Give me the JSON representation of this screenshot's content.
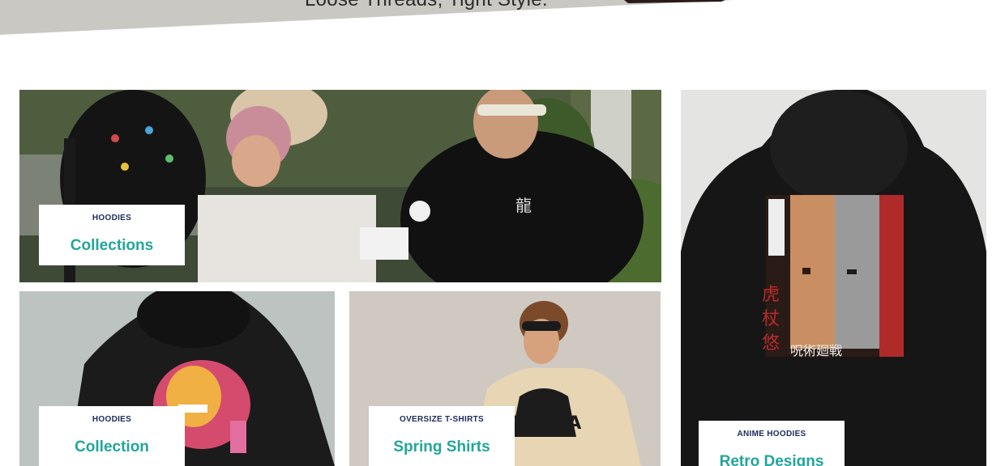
{
  "hero": {
    "tagline": "Loose Threads, Tight Style."
  },
  "collections": [
    {
      "category": "HOODIES",
      "title": "Collections",
      "photo": "group-of-friends-photo"
    },
    {
      "category": "HOODIES",
      "title": "Collection",
      "photo": "hoodie-back-print-photo"
    },
    {
      "category": "OVERSIZE T-SHIRTS",
      "title": "Spring Shirts",
      "photo": "oversize-tshirt-model-photo"
    },
    {
      "category": "ANIME HOODIES",
      "title": "Retro Designs",
      "photo": "anime-hoodie-back-photo"
    }
  ],
  "colors": {
    "accent": "#22a59a",
    "category_text": "#1d2a5c",
    "banner": "#c9c8c2"
  }
}
